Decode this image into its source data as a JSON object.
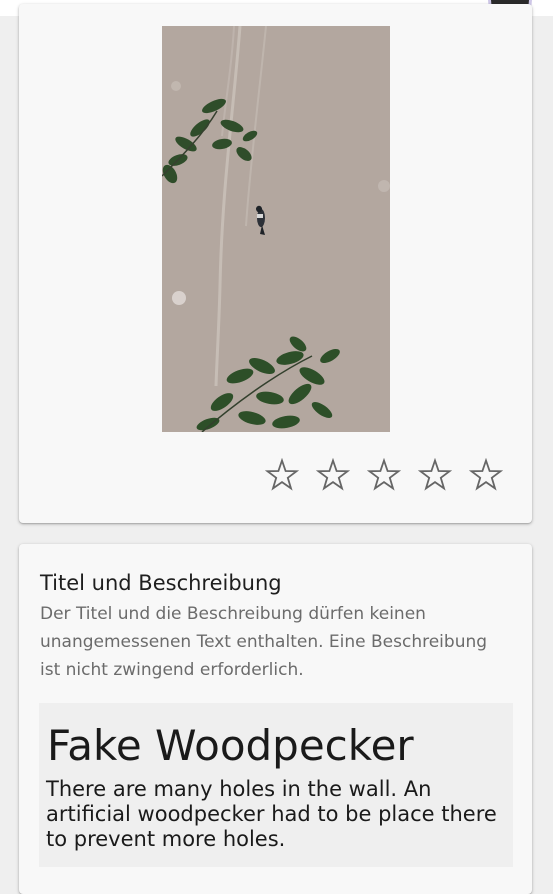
{
  "rating": {
    "stars": 5,
    "value": 0,
    "icon": "star-outline-icon",
    "color": "#666666"
  },
  "section": {
    "title": "Titel und Beschreibung",
    "description": "Der Titel und die Beschreibung dürfen keinen unangemessenen Text enthalten. Eine Beschreibung ist nicht zwingend erforderlich."
  },
  "preview": {
    "title": "Fake Woodpecker",
    "body": "There are many holes in the wall. An artificial woodpecker had to be place there to prevent more holes."
  },
  "colors": {
    "background": "#efefef",
    "card": "#f8f8f8",
    "wall": "#b3a79f"
  }
}
